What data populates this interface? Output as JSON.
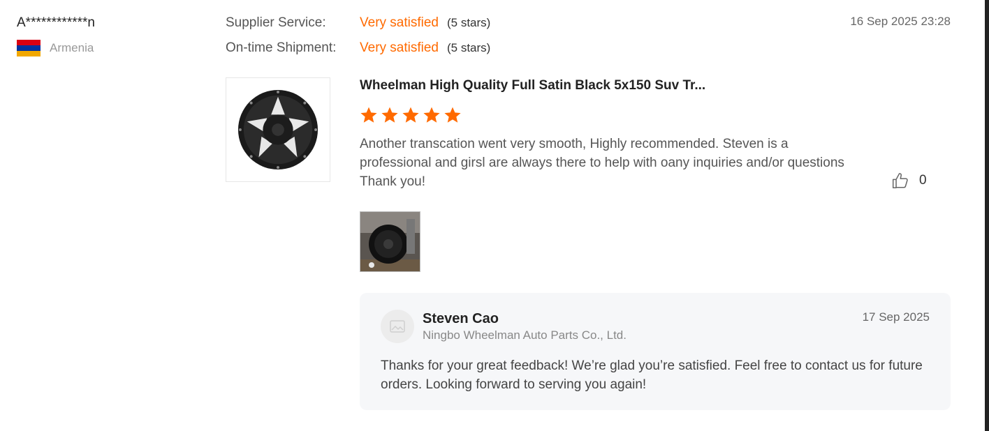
{
  "reviewer": {
    "name": "A************n",
    "country": "Armenia",
    "flag_colors": [
      "#d90012",
      "#0033a0",
      "#f2a800"
    ]
  },
  "ratings": [
    {
      "label": "Supplier Service:",
      "value": "Very satisfied",
      "stars_text": "(5 stars)"
    },
    {
      "label": "On-time Shipment:",
      "value": "Very satisfied",
      "stars_text": "(5 stars)"
    }
  ],
  "review_date": "16 Sep 2025 23:28",
  "product": {
    "title": "Wheelman High Quality Full Satin Black 5x150 Suv Tr...",
    "rating": 5,
    "thumbnail_icon": "alloy-wheel-image"
  },
  "review_text": "Another transcation went very smooth, Highly recommended. Steven is a professional and girsl are always there to help with oany inquiries and/or questions Thank you!",
  "like": {
    "icon": "thumbs-up-icon",
    "count": "0"
  },
  "review_photo_icon": "customer-photo",
  "reply": {
    "name": "Steven Cao",
    "company": "Ningbo Wheelman Auto Parts Co., Ltd.",
    "date": "17 Sep 2025",
    "text": "Thanks for your great feedback! We’re glad you’re satisfied. Feel free to contact us for future orders. Looking forward to serving you again!",
    "avatar_icon": "no-photo-avatar"
  },
  "colors": {
    "accent": "#ff6a00",
    "reply_bg": "#f6f7f9"
  }
}
